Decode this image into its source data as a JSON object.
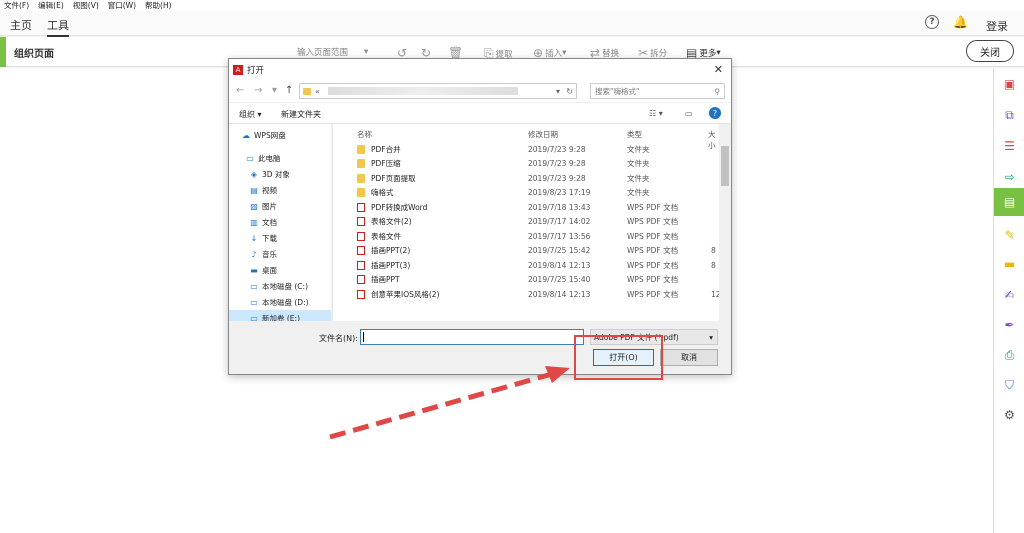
{
  "menu": [
    "文件(F)",
    "编辑(E)",
    "视图(V)",
    "窗口(W)",
    "帮助(H)"
  ],
  "tabs": {
    "home": "主页",
    "tools": "工具"
  },
  "login": "登录",
  "toolbar": {
    "title": "组织页面",
    "page_range": "输入页面范围",
    "extract": "提取",
    "insert": "插入",
    "replace": "替换",
    "split": "拆分",
    "more": "更多"
  },
  "close_label": "关闭",
  "dialog": {
    "title": "打开",
    "addr_prefix": "«",
    "search_placeholder": "搜索\"嗨格式\"",
    "organize": "组织 ▾",
    "new_folder": "新建文件夹",
    "nav": [
      {
        "icon": "☁",
        "label": "WPS网盘"
      },
      {
        "icon": "🖥",
        "label": "此电脑"
      },
      {
        "icon": "▣",
        "label": "3D 对象"
      },
      {
        "icon": "▤",
        "label": "视频"
      },
      {
        "icon": "▨",
        "label": "图片"
      },
      {
        "icon": "▥",
        "label": "文档"
      },
      {
        "icon": "↓",
        "label": "下载"
      },
      {
        "icon": "♪",
        "label": "音乐"
      },
      {
        "icon": "▬",
        "label": "桌面"
      },
      {
        "icon": "▭",
        "label": "本地磁盘 (C:)"
      },
      {
        "icon": "▭",
        "label": "本地磁盘 (D:)"
      },
      {
        "icon": "▭",
        "label": "新加卷 (E:)"
      }
    ],
    "columns": {
      "name": "名称",
      "date": "修改日期",
      "type": "类型",
      "size": "大小"
    },
    "files": [
      {
        "kind": "folder",
        "name": "PDF合并",
        "date": "2019/7/23 9:28",
        "type": "文件夹",
        "size": ""
      },
      {
        "kind": "folder",
        "name": "PDF压缩",
        "date": "2019/7/23 9:28",
        "type": "文件夹",
        "size": ""
      },
      {
        "kind": "folder",
        "name": "PDF页面提取",
        "date": "2019/7/23 9:28",
        "type": "文件夹",
        "size": ""
      },
      {
        "kind": "folder",
        "name": "嗨格式",
        "date": "2019/8/23 17:19",
        "type": "文件夹",
        "size": ""
      },
      {
        "kind": "pdf",
        "name": "PDF转换成Word",
        "date": "2019/7/18 13:43",
        "type": "WPS PDF 文档",
        "size": ""
      },
      {
        "kind": "pdf",
        "name": "表格文件(2)",
        "date": "2019/7/17 14:02",
        "type": "WPS PDF 文档",
        "size": ""
      },
      {
        "kind": "pdf",
        "name": "表格文件",
        "date": "2019/7/17 13:56",
        "type": "WPS PDF 文档",
        "size": ""
      },
      {
        "kind": "pdf",
        "name": "插画PPT(2)",
        "date": "2019/7/25 15:42",
        "type": "WPS PDF 文档",
        "size": "8"
      },
      {
        "kind": "pdf",
        "name": "插画PPT(3)",
        "date": "2019/8/14 12:13",
        "type": "WPS PDF 文档",
        "size": "8"
      },
      {
        "kind": "pdf",
        "name": "插画PPT",
        "date": "2019/7/25 15:40",
        "type": "WPS PDF 文档",
        "size": ""
      },
      {
        "kind": "pdf",
        "name": "创意苹果IOS风格(2)",
        "date": "2019/8/14 12:13",
        "type": "WPS PDF 文档",
        "size": "12"
      }
    ],
    "filename_label": "文件名(N):",
    "filename_value": "",
    "filetype": "Adobe PDF 文件 (*.pdf)",
    "open_label": "打开(O)",
    "cancel_label": "取消"
  },
  "colors": {
    "accent": "#7ac143",
    "arrow": "#e04848",
    "pdf": "#c8201d"
  }
}
